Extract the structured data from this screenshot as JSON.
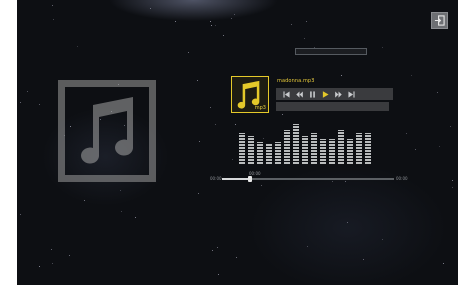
{
  "player": {
    "exit_icon": "exit-icon",
    "now_playing": {
      "filename": "madonna.mp3",
      "thumb_label": "mp3",
      "thumb_icon": "music-note-icon",
      "placeholder_icon": "music-note-icon"
    },
    "controls": [
      {
        "name": "skip-back-button",
        "icon": "skip-to-start-icon"
      },
      {
        "name": "rewind-button",
        "icon": "rewind-icon"
      },
      {
        "name": "pause-button",
        "icon": "pause-icon"
      },
      {
        "name": "play-button",
        "icon": "play-icon",
        "active": true
      },
      {
        "name": "fast-forward-button",
        "icon": "fast-forward-icon"
      },
      {
        "name": "skip-forward-button",
        "icon": "skip-to-end-icon"
      }
    ],
    "equalizer_levels": [
      0.78,
      0.7,
      0.55,
      0.5,
      0.55,
      0.85,
      1.0,
      0.7,
      0.78,
      0.62,
      0.62,
      0.85,
      0.62,
      0.78,
      0.78
    ],
    "progress": {
      "elapsed_label": "00:00",
      "total_label": "00:00",
      "current_label": "00:00",
      "fraction": 0.16
    },
    "colors": {
      "accent": "#e4c92a",
      "screen_bg": "#0d0f13"
    }
  }
}
